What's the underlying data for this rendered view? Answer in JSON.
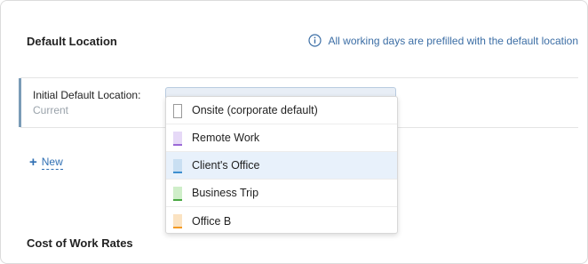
{
  "sections": {
    "default_location": {
      "title": "Default Location",
      "info_note": "All working days are prefilled with the default location"
    },
    "cost_rates": {
      "title": "Cost of Work Rates"
    }
  },
  "setting_row": {
    "label": "Initial Default Location:",
    "sublabel": "Current"
  },
  "dropdown": {
    "options": [
      {
        "label": "Onsite (corporate default)",
        "color": "#ffffff",
        "bar": "#ffffff",
        "selected": false
      },
      {
        "label": "Remote Work",
        "color": "#e6d9f7",
        "bar": "#9b6ad6",
        "selected": false
      },
      {
        "label": "Client's Office",
        "color": "#c9dff2",
        "bar": "#3e8fd0",
        "selected": true
      },
      {
        "label": "Business Trip",
        "color": "#cfeec9",
        "bar": "#49a843",
        "selected": false
      },
      {
        "label": "Office B",
        "color": "#fbe3c2",
        "bar": "#f39a24",
        "selected": false
      }
    ]
  },
  "new_link": {
    "label": "New",
    "icon": "plus-icon"
  },
  "colors": {
    "accent": "#7a9bb7",
    "link": "#2f6fb3",
    "info": "#3c6ea5"
  }
}
